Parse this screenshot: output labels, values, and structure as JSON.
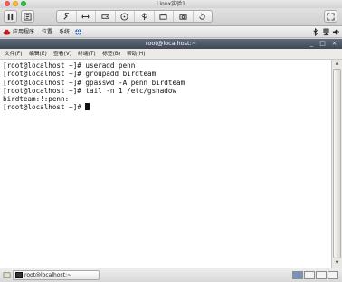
{
  "vm": {
    "title": "Linux实验1"
  },
  "guest_panel": {
    "menus": [
      "应用程序",
      "位置",
      "系统"
    ]
  },
  "terminal": {
    "title": "root@localhost:~",
    "menus": [
      "文件(F)",
      "编辑(E)",
      "查看(V)",
      "终端(T)",
      "标签(B)",
      "帮助(H)"
    ],
    "lines": [
      "[root@localhost ~]# useradd penn",
      "[root@localhost ~]# groupadd birdteam",
      "[root@localhost ~]# gpasswd -A penn birdteam",
      "[root@localhost ~]# tail -n 1 /etc/gshadow",
      "birdteam:!:penn:",
      "[root@localhost ~]# "
    ]
  },
  "taskbar": {
    "window_label": "root@localhost:~"
  },
  "icons": {
    "pause": "pause-icon",
    "settings": "settings-icon",
    "wrench": "wrench-icon",
    "network": "network-icon",
    "hdd": "disk-icon",
    "cd": "cd-icon",
    "usb": "usb-icon",
    "share": "share-icon",
    "camera": "camera-icon",
    "snapshot": "snapshot-icon",
    "fullscreen": "fullscreen-icon"
  }
}
